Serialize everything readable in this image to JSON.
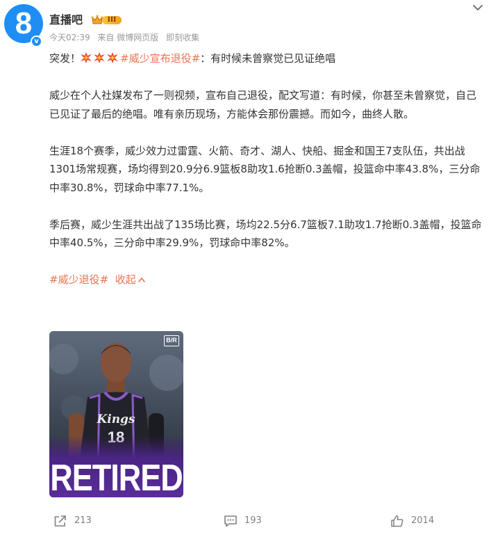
{
  "post": {
    "author": {
      "name": "直播吧",
      "avatar_glyph": "8",
      "avatar_color": "#1e8ef5",
      "verified_glyph": "v",
      "vip_level": "III"
    },
    "meta": {
      "time": "今天02:39",
      "source": "来自 微博网页版",
      "collect": "即刻收集"
    },
    "body": {
      "line1_prefix": "突发！",
      "line1_emoji": [
        "explosion-emoji",
        "explosion-emoji",
        "explosion-emoji"
      ],
      "line1_hashtag": "#威少宣布退役#",
      "line1_suffix": "：有时候未曾察觉已见证绝唱",
      "para1": "威少在个人社媒发布了一则视频，宣布自己退役，配文写道：有时候，你甚至未曾察觉，自己已见证了最后的绝唱。唯有亲历现场，方能体会那份震撼。而如今，曲终人散。",
      "para2": "生涯18个赛季，威少效力过雷霆、火箭、奇才、湖人、快船、掘金和国王7支队伍，共出战1301场常规赛，场均得到20.9分6.9篮板8助攻1.6抢断0.3盖帽，投篮命中率43.8%，三分命中率30.8%，罚球命中率77.1%。",
      "para3": "季后赛，威少生涯共出战了135场比赛，场均22.5分6.7篮板7.1助攻1.7抢断0.3盖帽，投篮命中率40.5%，三分命中率29.9%，罚球命中率82%。",
      "hashtag_footer": "#威少退役#",
      "collapse_label": "收起"
    },
    "image": {
      "badge": "B/R",
      "jersey_team": "Kings",
      "jersey_number": "18",
      "banner_text": "RETIRED"
    },
    "actions": {
      "reposts": "213",
      "comments": "193",
      "likes": "2014"
    }
  },
  "colors": {
    "link": "#eb7350",
    "meta": "#999999",
    "text": "#333333",
    "brand": "#1e8ef5",
    "banner_purple": "#5a2d9a"
  }
}
